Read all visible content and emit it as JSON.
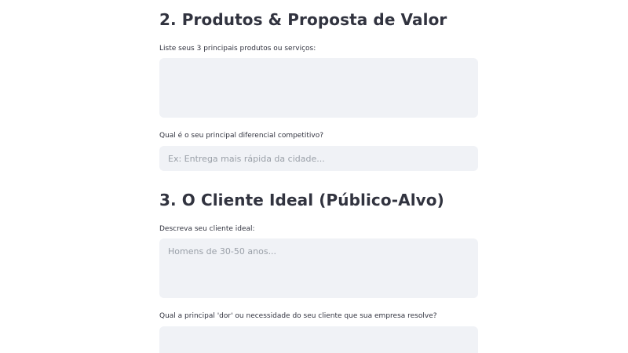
{
  "sections": [
    {
      "title": "2. Produtos & Proposta de Valor",
      "fields": [
        {
          "label": "Liste seus 3 principais produtos ou serviços:",
          "placeholder": "",
          "value": ""
        },
        {
          "label": "Qual é o seu principal diferencial competitivo?",
          "placeholder": "Ex: Entrega mais rápida da cidade...",
          "value": ""
        }
      ]
    },
    {
      "title": "3. O Cliente Ideal (Público-Alvo)",
      "fields": [
        {
          "label": "Descreva seu cliente ideal:",
          "placeholder": "Homens de 30-50 anos...",
          "value": ""
        },
        {
          "label": "Qual a principal 'dor' ou necessidade do seu cliente que sua empresa resolve?",
          "placeholder": "",
          "value": ""
        }
      ]
    }
  ],
  "colors": {
    "text": "#31333f",
    "field_background": "#f0f2f6",
    "placeholder": "#9aa0a8",
    "page_background": "#ffffff"
  }
}
